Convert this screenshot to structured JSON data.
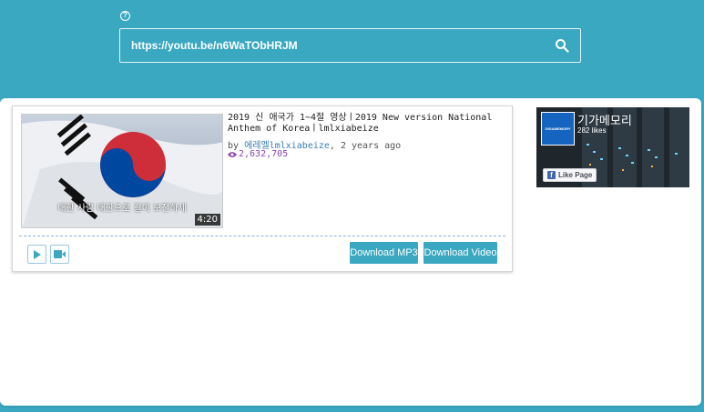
{
  "header": {
    "help_glyph": "?",
    "search_value": "https://youtu.be/n6WaTObHRJM"
  },
  "video": {
    "title": "2019 신 애국가 1~4절 영상ㅣ2019 New version National Anthem of Koreaㅣlmlxiabeize",
    "by_prefix": "by",
    "author": "에레멜lmlxiabeize",
    "age": ", 2 years ago",
    "views": "2,632,705",
    "duration": "4:20",
    "caption": "대한 사람 대한으로 길이 보전하세"
  },
  "actions": {
    "download_mp3": "Download MP3",
    "download_video": "Download Video"
  },
  "facebook": {
    "page_name": "기가메모리",
    "likes": "282 likes",
    "like_button": "Like Page",
    "logo_text": "GIGAMEMORY"
  },
  "colors": {
    "brand": "#3aa8c1",
    "author_link": "#3a7fb5",
    "views": "#8e44ad"
  }
}
